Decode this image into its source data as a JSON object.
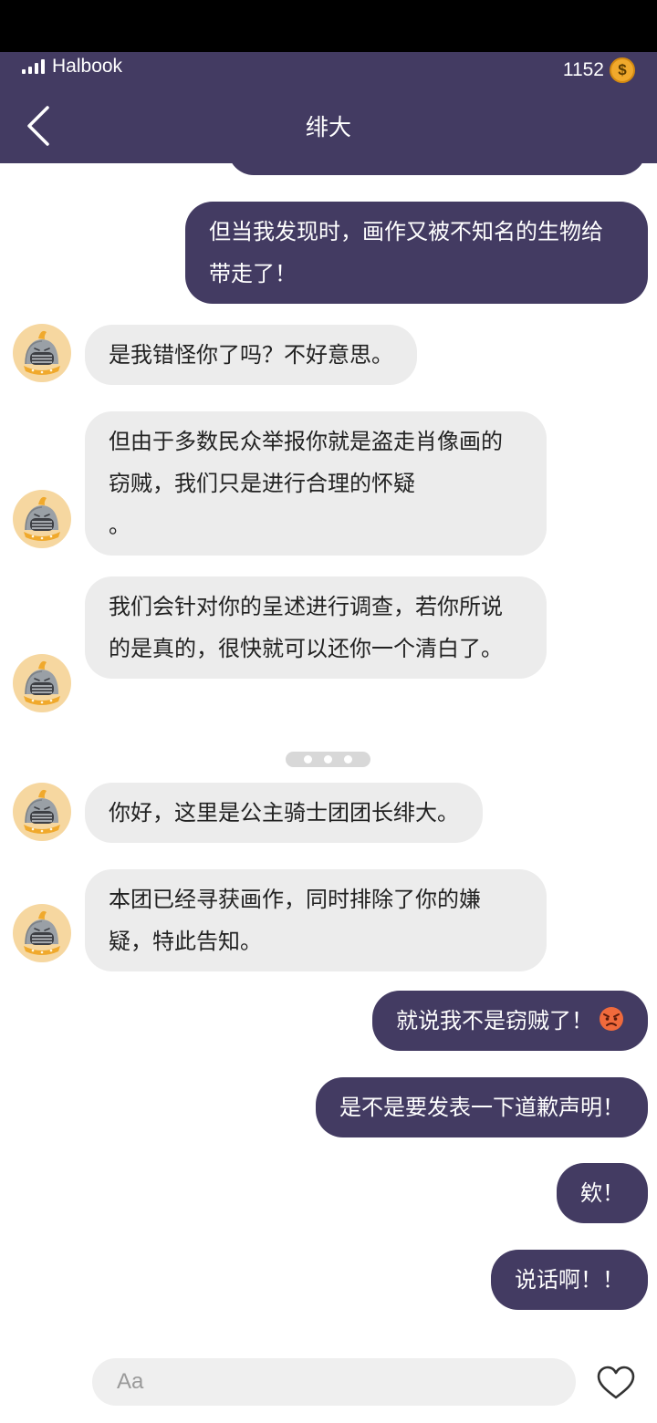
{
  "status_bar": {
    "carrier": "Halbook"
  },
  "header": {
    "title": "绯大",
    "coins": "1152",
    "coin_symbol": "$"
  },
  "avatar_icon": "knight-helmet-icon",
  "typing_indicator": "three-dots",
  "messages": [
    {
      "side": "out",
      "text": "但当我发现时，画作又被不知名的生物给带走了！"
    },
    {
      "side": "in",
      "text": "是我错怪你了吗？不好意思。"
    },
    {
      "side": "in",
      "text": "但由于多数民众举报你就是盗走肖像画的窃贼，我们只是进行合理的怀疑\n。"
    },
    {
      "side": "in",
      "text": "我们会针对你的呈述进行调查，若你所说的是真的，很快就可以还你一个清白了。"
    },
    {
      "side": "in",
      "text": "你好，这里是公主骑士团团长绯大。"
    },
    {
      "side": "in",
      "text": "本团已经寻获画作，同时排除了你的嫌疑，特此告知。"
    },
    {
      "side": "out",
      "text": "就说我不是窃贼了！",
      "emoji": "angry-face-icon"
    },
    {
      "side": "out",
      "text": "是不是要发表一下道歉声明！"
    },
    {
      "side": "out",
      "text": "欸！"
    },
    {
      "side": "out",
      "text": "说话啊！！"
    }
  ],
  "input": {
    "placeholder": "Aa"
  },
  "colors": {
    "header": "#433b62",
    "outgoing_bubble": "#433b62",
    "incoming_bubble": "#ececec",
    "coin": "#f0a92c"
  }
}
